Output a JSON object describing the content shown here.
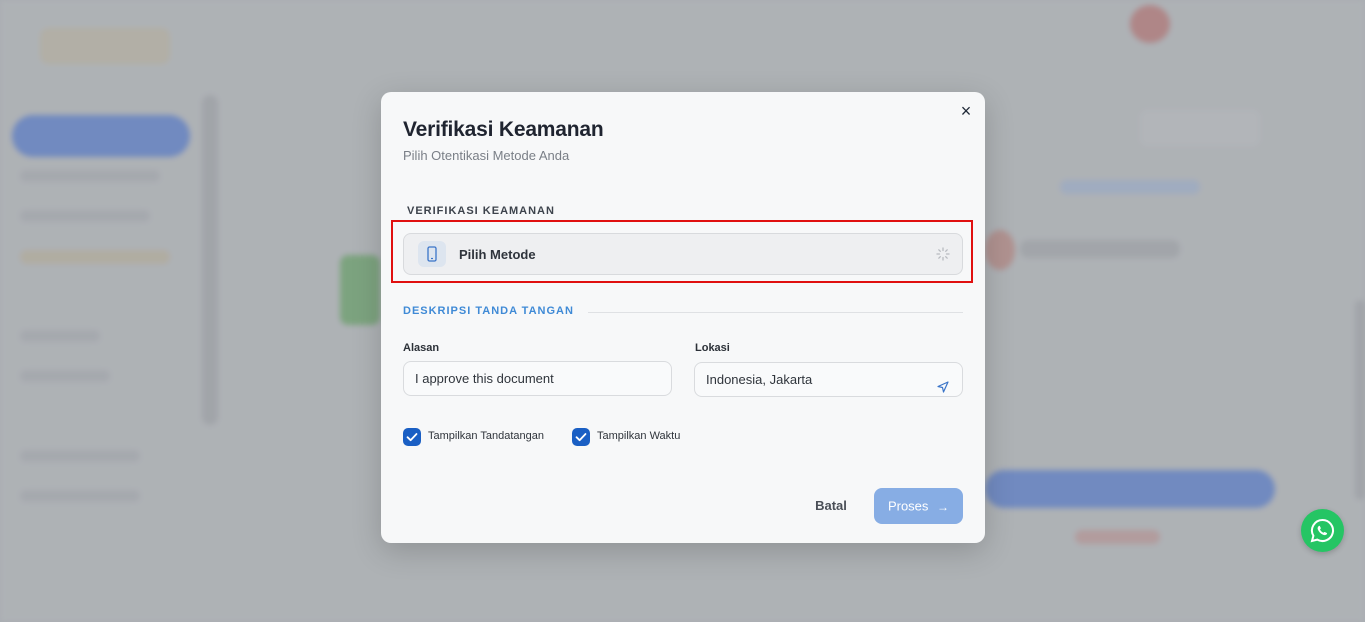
{
  "modal": {
    "title": "Verifikasi Keamanan",
    "subtitle": "Pilih Otentikasi Metode Anda",
    "close_symbol": "×",
    "security_section_label": "VERIFIKASI KEAMANAN",
    "method_select_label": "Pilih Metode",
    "description_section_label": "DESKRIPSI TANDA TANGAN",
    "reason": {
      "label": "Alasan",
      "value": "I approve this document"
    },
    "location": {
      "label": "Lokasi",
      "value": "Indonesia, Jakarta"
    },
    "checkboxes": [
      {
        "label": "Tampilkan Tandatangan",
        "checked": true
      },
      {
        "label": "Tampilkan Waktu",
        "checked": true
      }
    ],
    "cancel_label": "Batal",
    "proceed_label": "Proses",
    "proceed_arrow": "→"
  },
  "icons": {
    "method": "smartphone-icon",
    "spinner": "loading-spinner-icon",
    "location": "navigation-arrow-icon",
    "whatsapp": "whatsapp-icon"
  },
  "colors": {
    "primary": "#1a5fc4",
    "section_accent": "#3f8ad6",
    "proceed_disabled": "#87ade4",
    "highlight": "#e01010",
    "whatsapp": "#25c564"
  }
}
